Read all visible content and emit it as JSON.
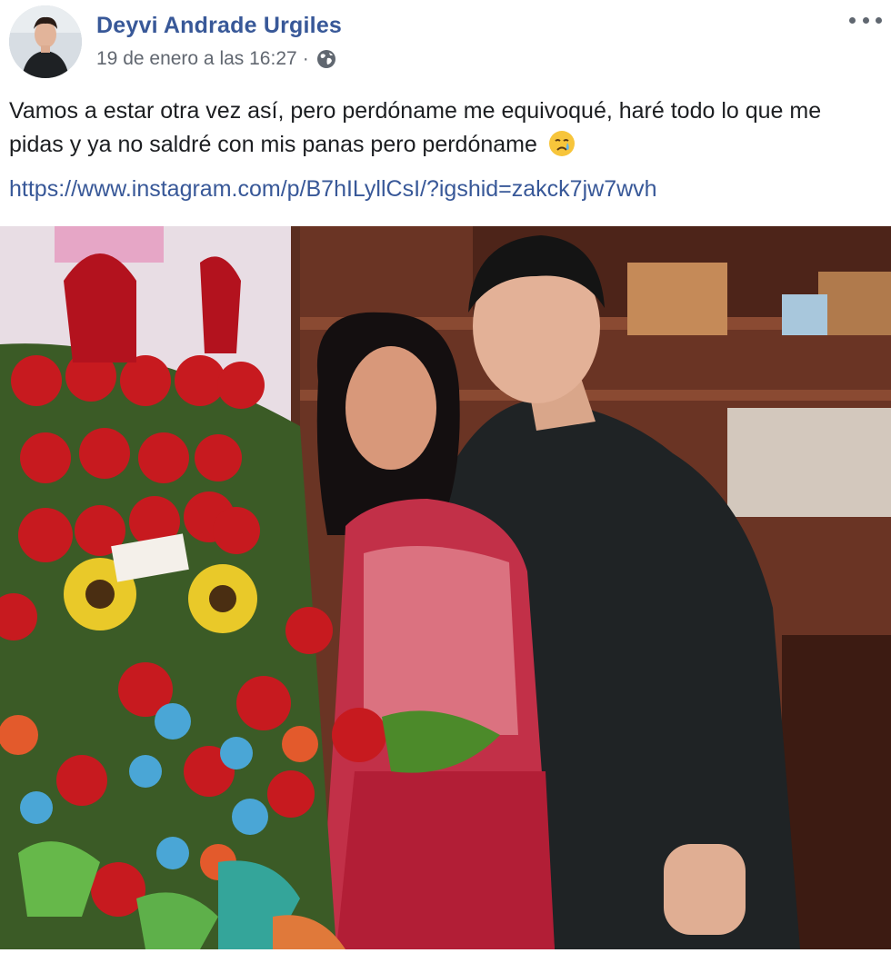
{
  "post": {
    "author": "Deyvi Andrade Urgiles",
    "timestamp": "19 de enero a las 16:27",
    "separator": "·",
    "privacy_icon": "globe-icon",
    "more_icon": "more-options-icon",
    "text": "Vamos a estar otra vez así, pero perdóname me equivoqué, haré todo lo que me pidas y ya no saldré con mis panas pero perdóname",
    "emoji": "crying-face-emoji",
    "link": "https://www.instagram.com/p/B7hILyllCsI/?igshid=zakck7jw7wvh"
  },
  "colors": {
    "author_link": "#385898",
    "meta_text": "#616770",
    "body_text": "#1c1e21"
  }
}
